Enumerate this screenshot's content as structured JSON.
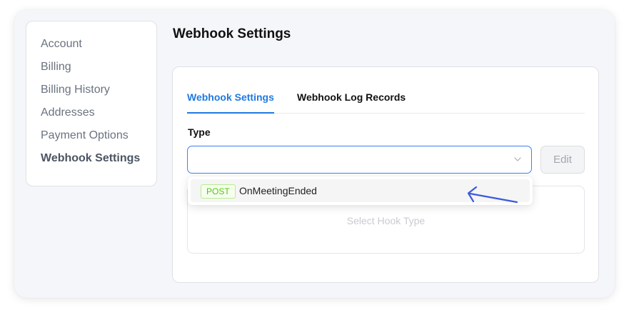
{
  "sidebar": {
    "items": [
      {
        "label": "Account"
      },
      {
        "label": "Billing"
      },
      {
        "label": "Billing History"
      },
      {
        "label": "Addresses"
      },
      {
        "label": "Payment Options"
      },
      {
        "label": "Webhook Settings",
        "active": true
      }
    ]
  },
  "page": {
    "title": "Webhook Settings"
  },
  "tabs": [
    {
      "label": "Webhook Settings",
      "active": true
    },
    {
      "label": "Webhook Log Records",
      "active": false
    }
  ],
  "form": {
    "type_label": "Type",
    "select_value": "",
    "edit_label": "Edit"
  },
  "dropdown": {
    "options": [
      {
        "method": "POST",
        "label": "OnMeetingEnded"
      }
    ]
  },
  "empty_state": {
    "text": "Select Hook Type"
  },
  "icons": {
    "select_chevron": "chevron-down-icon",
    "annotation": "arrow-pointer-icon"
  },
  "colors": {
    "accent": "#1f7ae0",
    "annotation_arrow": "#3b5bdb",
    "badge_green": "#52c41a"
  }
}
